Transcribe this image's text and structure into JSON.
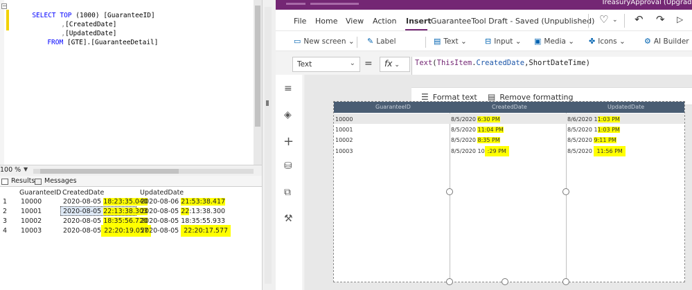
{
  "ssms": {
    "sql": {
      "line1_kw1": "SELECT TOP",
      "line1_num": "(1000)",
      "line1_col": "[GuaranteeID]",
      "line2_comma": ",",
      "line2_col": "[CreatedDate]",
      "line3_comma": ",",
      "line3_col": "[UpdatedDate]",
      "line4_kw": "FROM",
      "line4_table": "[GTE].[GuaranteeDetail]"
    },
    "zoom": "100 %",
    "tabs": {
      "results": "Results",
      "messages": "Messages"
    },
    "grid": {
      "headers": [
        "GuaranteeID",
        "CreatedDate",
        "UpdatedDate"
      ],
      "rows": [
        {
          "num": "1",
          "id": "10000",
          "created_date": "2020-08-05",
          "created_time": "18:23:35.040",
          "updated_date": "2020-08-06",
          "updated_time": "21:53:38.417"
        },
        {
          "num": "2",
          "id": "10001",
          "created_date": "2020-08-05",
          "created_time": "22:13:38.303",
          "updated_date": "2020-08-05",
          "updated_time_a": "22",
          "updated_time_b": ":13:38.300"
        },
        {
          "num": "3",
          "id": "10002",
          "created_date": "2020-08-05",
          "created_time": "18:35:56.720",
          "updated_date": "2020-08-05",
          "updated_time": "18:35:55.933"
        },
        {
          "num": "4",
          "id": "10003",
          "created_date": "2020-08-05",
          "created_time": "22:20:19.057",
          "updated_date": "2020-08-05",
          "updated_time": "22:20:17.577"
        }
      ]
    }
  },
  "powerapps": {
    "titlebar_app": "TreasuryApproval (Upgrade)",
    "menu": [
      "File",
      "Home",
      "View",
      "Action",
      "Insert"
    ],
    "doc_title": "GuaranteeTool Draft - Saved (Unpublished)",
    "ribbon": {
      "new_screen": "New screen",
      "label": "Label",
      "text": "Text",
      "input": "Input",
      "media": "Media",
      "icons": "Icons",
      "ai_builder": "AI Builder"
    },
    "property": "Text",
    "equals": "=",
    "fx": "fx",
    "formula": {
      "fn": "Text",
      "open": "(",
      "this": "ThisItem",
      "dot": ".",
      "prop": "CreatedDate",
      "rest": ",ShortDateTime)"
    },
    "format_text": "Format text",
    "remove_formatting": "Remove formatting",
    "gallery": {
      "headers": [
        "GuaranteeID",
        "CreatedDate",
        "UpdatedDate"
      ],
      "rows": [
        {
          "id": "10000",
          "c_date": "8/5/2020 ",
          "c_hl": "6:30 PM",
          "u_date": "8/6/2020 1",
          "u_hl": "1:03 PM"
        },
        {
          "id": "10001",
          "c_date": "8/5/2020 ",
          "c_hl": "11:04 PM",
          "u_date": "8/5/2020 1",
          "u_hl": "1:03 PM"
        },
        {
          "id": "10002",
          "c_date": "8/5/2020 ",
          "c_hl": "8:35 PM",
          "u_date": "8/5/2020 ",
          "u_hl": "9:11 PM"
        },
        {
          "id": "10003",
          "c_date": "8/5/2020 10",
          "c_hl": ":29 PM",
          "u_date": "8/5/2020 ",
          "u_hl": "11:56 PM"
        }
      ]
    }
  },
  "colors": {
    "accent": "#742774",
    "highlight": "#ffff00",
    "header": "#4a5d73"
  }
}
